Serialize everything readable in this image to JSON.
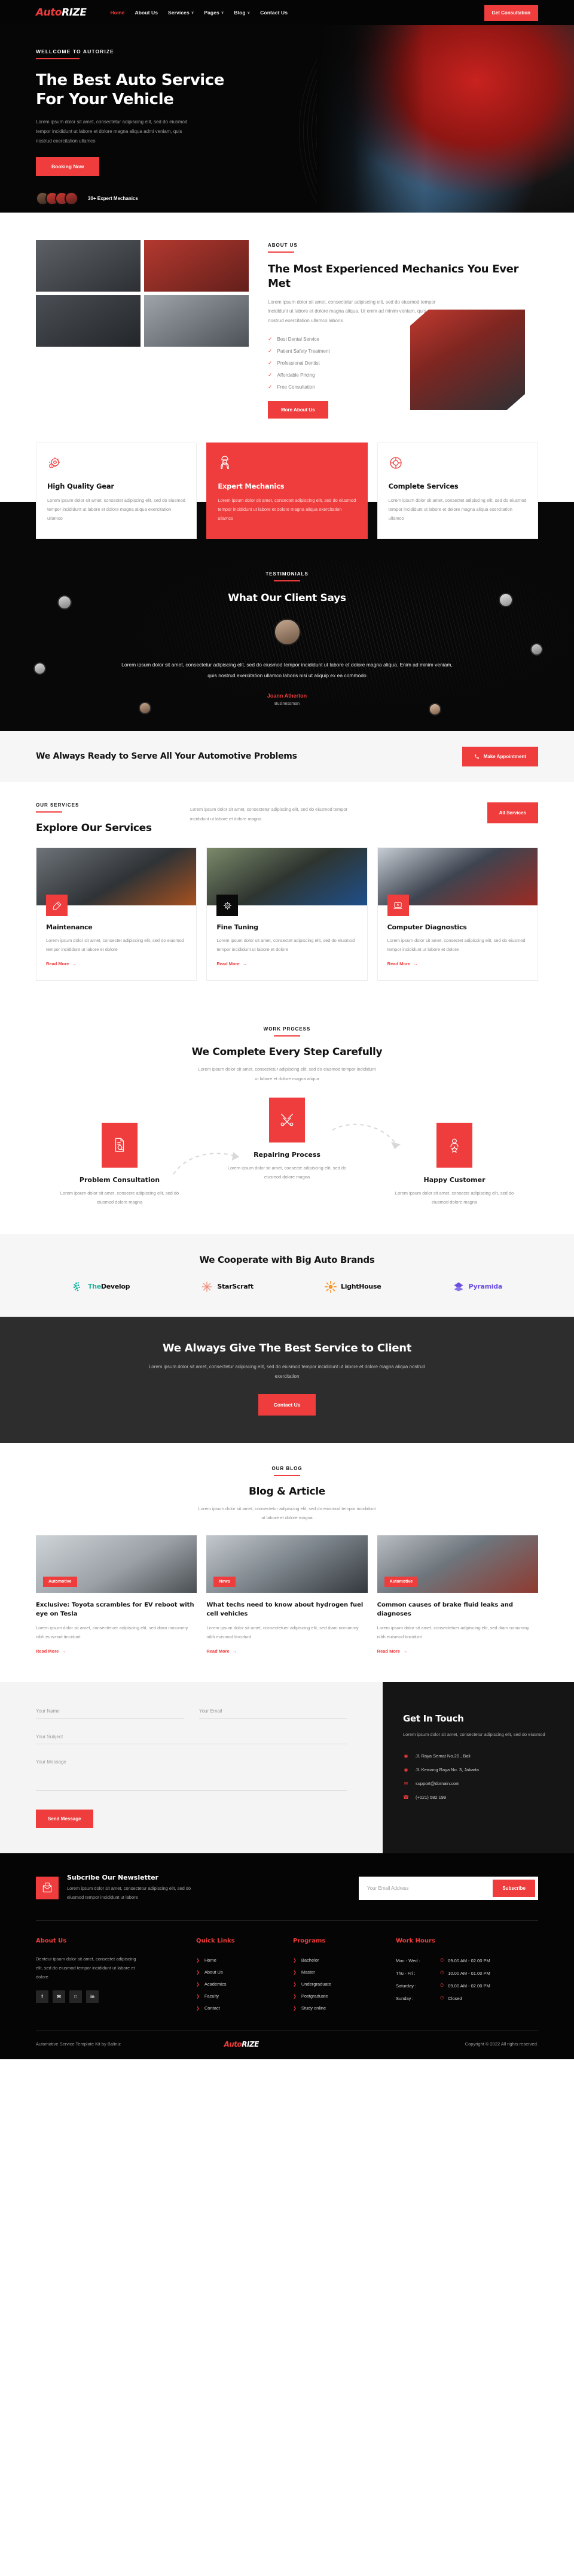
{
  "brand": {
    "name_part1": "Auto",
    "name_part2": "RIZE",
    "accent": "#ef3c3c"
  },
  "header": {
    "nav": [
      {
        "label": "Home",
        "caret": "",
        "active": true
      },
      {
        "label": "About Us",
        "caret": "",
        "active": false
      },
      {
        "label": "Services",
        "caret": "∨",
        "active": false
      },
      {
        "label": "Pages",
        "caret": "∨",
        "active": false
      },
      {
        "label": "Blog",
        "caret": "∨",
        "active": false
      },
      {
        "label": "Contact Us",
        "caret": "",
        "active": false
      }
    ],
    "cta_label": "Get Consultation"
  },
  "hero": {
    "eyebrow": "WELLCOME TO AUTORIZE",
    "title": "The Best Auto Service For Your Vehicle",
    "paragraph": "Lorem ipsum dolor sit amet, consectetur adipiscing elit, sed do eiusmod tempor incididunt ut labore et dolore magna aliqua admi veniam, quis nostrud exercitation ullamco",
    "button": "Booking Now",
    "mechanics_label": "30+ Expert Mechanics"
  },
  "about": {
    "eyebrow": "ABOUT US",
    "title": "The Most Experienced Mechanics You Ever Met",
    "paragraph": "Lorem ipsum dolor sit amet, consectetur adipiscing elit, sed do eiusmod tempor incididunt ut labore et dolore magna aliqua. Ut enim ad minim veniam, quis nostrud exercitation ullamco laboris",
    "checks": [
      "Best Dental Service",
      "Patient Safety Treatment",
      "Professional Dentist",
      "Affordable Pricing",
      "Free Consultation"
    ],
    "button": "More About Us"
  },
  "features": [
    {
      "icon": "gear-icon",
      "title": "High Quality Gear",
      "text": "Lorem ipsum dolor sit amet, consectet adipiscing elit, sed do eiusmod tempor incididunt ut labore et dolore magna aliqua exercitation ullamco",
      "highlight": false
    },
    {
      "icon": "mechanic-icon",
      "title": "Expert Mechanics",
      "text": "Lorem ipsum dolor sit amet, consectet adipiscing elit, sed do eiusmod tempor incididunt ut labore et dolore magna aliqua exercitation ullamco",
      "highlight": true
    },
    {
      "icon": "wheel-icon",
      "title": "Complete Services",
      "text": "Lorem ipsum dolor sit amet, consectet adipiscing elit, sed do eiusmod tempor incididunt ut labore et dolore magna aliqua exercitation ullamco",
      "highlight": false
    }
  ],
  "testimonials": {
    "eyebrow": "TESTIMONIALS",
    "title": "What Our Client Says",
    "quote": "Lorem ipsum dolor sit amet, consectetur adipiscing elit, sed do eiusmod tempor incididunt ut labore et dolore magna aliqua. Enim ad minim veniam, quis nostrud exercitation ullamco laboris nisi ut aliquip ex ea commodo",
    "author": "Joann Atherton",
    "role": "Businessman"
  },
  "cta_strip": {
    "title": "We Always Ready to Serve All Your Automotive Problems",
    "button": "Make Appointment",
    "button_icon": "phone-icon"
  },
  "services": {
    "eyebrow": "OUR SERVICES",
    "title": "Explore Our Services",
    "paragraph": "Lorem ipsum dolor sit amet, consectetur adipiscing elit, sed do eiusmod tempor incididunt ut labore et dolore magna",
    "all_button": "All Services",
    "items": [
      {
        "icon": "screwdriver-icon",
        "title": "Maintenance",
        "text": "Lorem ipsum dolor sit amet, consectet adipiscing elit, sed do eiusmod tempor incididunt ut labore et dolore",
        "link": "Read More",
        "badge_dark": false
      },
      {
        "icon": "gear-icon",
        "title": "Fine Tuning",
        "text": "Lorem ipsum dolor sit amet, consectet adipiscing elit, sed do eiusmod tempor incididunt ut labore et dolore",
        "link": "Read More",
        "badge_dark": true
      },
      {
        "icon": "laptop-icon",
        "title": "Computer Diagnostics",
        "text": "Lorem ipsum dolor sit amet, consectet adipiscing elit, sed do eiusmod tempor incididunt ut labore et dolore",
        "link": "Read More",
        "badge_dark": false
      }
    ]
  },
  "process": {
    "eyebrow": "WORK PROCESS",
    "title": "We Complete Every Step Carefully",
    "paragraph": "Lorem ipsum dolor sit amet, consectetur adipiscing elit, sed do eiusmod tempor incididunt ut labore et dolore magna aliqua",
    "steps": [
      {
        "icon": "document-search-icon",
        "title": "Problem Consultation",
        "text": "Lorem ipsum dolor sit amet, consecte adipiscing elit, sed do eiusmod dolore magna"
      },
      {
        "icon": "tools-icon",
        "title": "Repairing Process",
        "text": "Lorem ipsum dolor sit amet, consecte adipiscing elit, sed do eiusmod dolore magna"
      },
      {
        "icon": "customer-rating-icon",
        "title": "Happy Customer",
        "text": "Lorem ipsum dolor sit amet, consecte adipiscing elit, sed do eiusmod dolore magna"
      }
    ]
  },
  "brands": {
    "title": "We Cooperate with Big Auto Brands",
    "items": [
      {
        "icon": "dots-icon",
        "name_a": "The",
        "name_b": "Develop",
        "color_a": "#19b5a0",
        "color_b": "#111111",
        "icon_color": "#19b5a0"
      },
      {
        "icon": "starburst-icon",
        "name_a": "Star",
        "name_b": "Scraft",
        "color_a": "#111111",
        "color_b": "#111111",
        "icon_color": "#f08a7a"
      },
      {
        "icon": "sun-icon",
        "name_a": "Light",
        "name_b": "House",
        "color_a": "#111111",
        "color_b": "#111111",
        "icon_color": "#f79321"
      },
      {
        "icon": "diamond-icon",
        "name_a": "Pyr",
        "name_b": "amida",
        "color_a": "#6c4fe0",
        "color_b": "#6c4fe0",
        "icon_color": "#6c4fe0"
      }
    ]
  },
  "dark_cta": {
    "title": "We Always Give The Best Service to Client",
    "paragraph": "Lorem ipsum dolor sit amet, consectetur adipiscing elit, sed do eiusmod tempor incididunt ut labore et dolore magna aliqua nostrud exercitation",
    "button": "Contact Us"
  },
  "blog": {
    "eyebrow": "OUR BLOG",
    "title": "Blog & Article",
    "paragraph": "Lorem ipsum dolor sit amet, consectetur adipiscing elit, sed do eiusmod tempor incididunt ut labore et dolore magna",
    "posts": [
      {
        "tag": "Automotive",
        "title": "Exclusive: Toyota scrambles for EV reboot with eye on Tesla",
        "text": "Lorem ipsum dolor sit amet, consectetuer adipiscing elit, sed diam nonummy nibh euismod tincidunt",
        "link": "Read More"
      },
      {
        "tag": "News",
        "title": "What techs need to know about hydrogen fuel cell vehicles",
        "text": "Lorem ipsum dolor sit amet, consectetuer adipiscing elit, sed diam nonummy nibh euismod tincidunt",
        "link": "Read More"
      },
      {
        "tag": "Automotive",
        "title": "Common causes of brake fluid leaks and diagnoses",
        "text": "Lorem ipsum dolor sit amet, consectetuer adipiscing elit, sed diam nonummy nibh euismod tincidunt",
        "link": "Read More"
      }
    ]
  },
  "contact": {
    "name_placeholder": "Your Name",
    "email_placeholder": "Your Email",
    "subject_placeholder": "Your Subject",
    "message_placeholder": "Your Message",
    "send_button": "Send Message",
    "get_in_touch": {
      "title": "Get In Touch",
      "paragraph": "Lorem ipsum dolor sit amet, consectetur adipiscing elit, sed do eiusmod",
      "items": [
        {
          "icon": "location-pin-icon",
          "glyph": "◉",
          "text": "Jl. Raya Semat No.20 , Bali"
        },
        {
          "icon": "location-pin-icon",
          "glyph": "◉",
          "text": "Jl. Kemang Raya No. 3, Jakarta"
        },
        {
          "icon": "mail-icon",
          "glyph": "✉",
          "text": "support@domain.com"
        },
        {
          "icon": "phone-icon",
          "glyph": "☎",
          "text": "(+021) 582 198"
        }
      ]
    }
  },
  "newsletter": {
    "icon": "newsletter-envelope-icon",
    "title": "Subcribe Our Newsletter",
    "paragraph": "Lorem ipsum dolor sit amet, consectetur adipiscing elit, sed do eiusmod tempor incididunt ut labore",
    "email_placeholder": "Your Email Address",
    "button": "Subscribe"
  },
  "footer": {
    "about": {
      "heading": "About Us",
      "text": "Denteur ipsum dolor sit amet, consectet adipiscing elit, sed do eiusmod tempor incididunt ut labore et dolore",
      "socials": [
        {
          "icon": "facebook-icon",
          "glyph": "f"
        },
        {
          "icon": "twitter-icon",
          "glyph": "✉"
        },
        {
          "icon": "instagram-icon",
          "glyph": "□"
        },
        {
          "icon": "linkedin-icon",
          "glyph": "in"
        }
      ]
    },
    "quick_links": {
      "heading": "Quick Links",
      "items": [
        "Home",
        "About Us",
        "Academics",
        "Faculty",
        "Contact"
      ]
    },
    "programs": {
      "heading": "Programs",
      "items": [
        "Bachelor",
        "Master",
        "Undergraduate",
        "Postgraduate",
        "Study online"
      ]
    },
    "work_hours": {
      "heading": "Work Hours",
      "rows": [
        {
          "day": "Mon - Wed :",
          "time": "09.00 AM - 02.00 PM"
        },
        {
          "day": "Thu - Fri :",
          "time": "10.00 AM - 01.00 PM"
        },
        {
          "day": "Saturday :",
          "time": "09.00 AM - 02.00 PM"
        },
        {
          "day": "Sunday :",
          "time": "Closed"
        }
      ]
    },
    "bottom_left": "Automotive Service Template Kit by Baliniz",
    "bottom_right": "Copyright © 2022 All rights reserved."
  }
}
